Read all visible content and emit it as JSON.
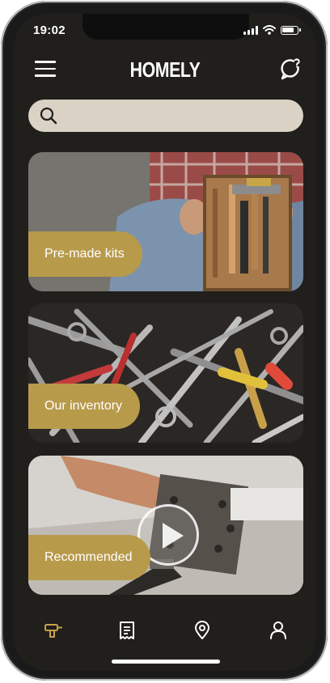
{
  "status_bar": {
    "time": "19:02"
  },
  "header": {
    "title": "HOMELY"
  },
  "search": {
    "placeholder": "",
    "value": ""
  },
  "cards": [
    {
      "label": "Pre-made kits"
    },
    {
      "label": "Our inventory"
    },
    {
      "label": "Recommended"
    }
  ],
  "bottom_nav": {
    "items": [
      {
        "icon": "drill-icon",
        "active": true
      },
      {
        "icon": "receipt-icon",
        "active": false
      },
      {
        "icon": "location-pin-icon",
        "active": false
      },
      {
        "icon": "profile-icon",
        "active": false
      }
    ]
  },
  "colors": {
    "background": "#211f1c",
    "accent": "#b89a4b",
    "search_bg": "#d9d2c5",
    "nav_active": "#c9a04a"
  }
}
